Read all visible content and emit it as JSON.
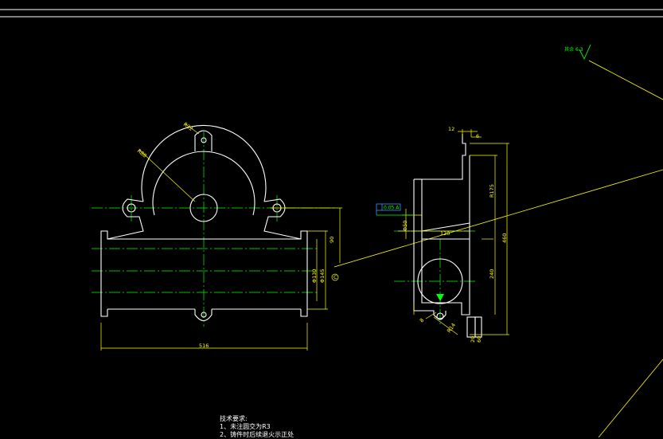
{
  "colors": {
    "background": "#000000",
    "outline": "#ffffff",
    "dimension": "#ffff00",
    "center_line": "#00ff00",
    "annotation": "#00ff00",
    "datum": "#3399ff"
  },
  "front_view": {
    "radius_small": "R22",
    "radius_large": "R88",
    "dim_width": "516",
    "dim_h1": "90",
    "dim_d1": "Φ130",
    "dim_d2": "Φ145",
    "datum_tag": "C"
  },
  "side_view": {
    "dim_top_left": "12",
    "dim_top_right": "6",
    "dim_r": "R175",
    "dim_middle": "120",
    "dim_height": "460",
    "dim_h2": "240",
    "dim_d": "Φ50",
    "dim_r_bottom": "R14",
    "dim_bottom_left": "20",
    "dim_bottom_right": "60",
    "dim_small": "8",
    "tolerance_frame": "0.05 A"
  },
  "roughness": {
    "text": "其余",
    "value": "6.3"
  },
  "notes": {
    "title": "技术要求:",
    "line1": "1、未注圆交为R3",
    "line2": "2、铸件时后续退火示正处"
  }
}
